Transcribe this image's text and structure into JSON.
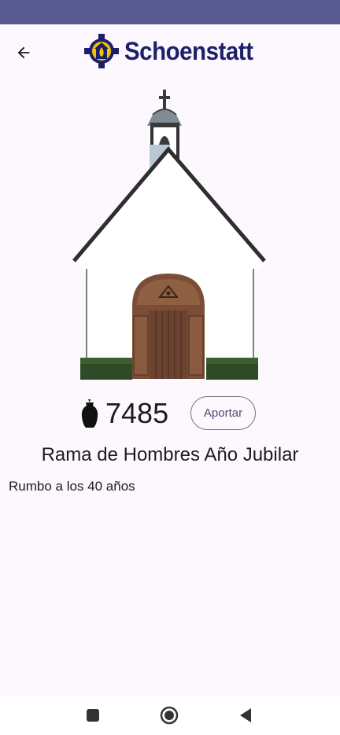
{
  "header": {
    "back_icon": "arrow-left-icon",
    "logo_text": "Schoenstatt",
    "brand_colors": {
      "navy": "#1d1f6b",
      "gold": "#f3c300",
      "status_bar": "#5a5a92"
    }
  },
  "shrine": {
    "image": "schoenstatt-shrine-illustration"
  },
  "counter": {
    "icon": "vase-icon",
    "value": "7485",
    "button_label": "Aportar"
  },
  "campaign": {
    "title": "Rama de Hombres Año Jubilar",
    "subtitle": "Rumbo a los 40 años"
  },
  "nav": {
    "recents_icon": "square-icon",
    "home_icon": "circle-icon",
    "back_icon": "triangle-back-icon"
  }
}
